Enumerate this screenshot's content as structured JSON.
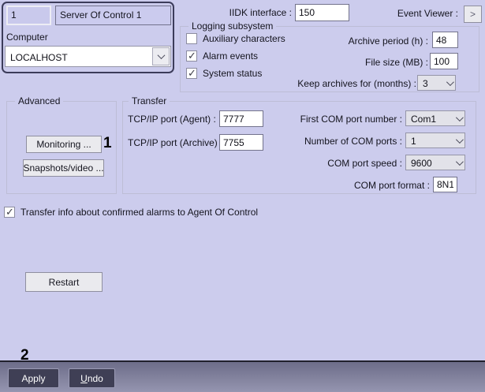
{
  "identity": {
    "id_value": "1",
    "name_value": "Server Of Control 1",
    "computer_label": "Computer",
    "computer_value": "LOCALHOST"
  },
  "iidk": {
    "label": "IIDK interface :",
    "value": "150"
  },
  "event_viewer": {
    "label": "Event Viewer :",
    "button_glyph": ">"
  },
  "logging": {
    "title": "Logging subsystem",
    "checkboxes": [
      {
        "label": "Auxiliary characters",
        "checked": false
      },
      {
        "label": "Alarm events",
        "checked": true
      },
      {
        "label": "System status",
        "checked": true
      }
    ],
    "archive_period_label": "Archive period (h) :",
    "archive_period_value": "48",
    "file_size_label": "File size (MB) :",
    "file_size_value": "100",
    "keep_archives_label": "Keep archives for (months) :",
    "keep_archives_value": "3"
  },
  "advanced": {
    "title": "Advanced",
    "monitoring_button": "Monitoring ...",
    "snapshots_button": "Snapshots/video ...",
    "annotation": "1"
  },
  "transfer": {
    "title": "Transfer",
    "agent_port_label": "TCP/IP port (Agent) :",
    "agent_port_value": "7777",
    "archive_port_label": "TCP/IP port (Archive) :",
    "archive_port_value": "7755",
    "first_com_label": "First COM port number :",
    "first_com_value": "Com1",
    "num_com_label": "Number of COM ports :",
    "num_com_value": "1",
    "com_speed_label": "COM port speed :",
    "com_speed_value": "9600",
    "com_format_label": "COM port format :",
    "com_format_value": "8N1"
  },
  "transfer_info": {
    "label": "Transfer info about confirmed alarms to Agent Of Control",
    "checked": true
  },
  "restart_button": "Restart",
  "footer": {
    "annotation": "2",
    "apply_button": "Apply",
    "undo_accel": "U",
    "undo_rest": "ndo"
  },
  "colors": {
    "background": "#cccced",
    "footer_top": "#6d6d89",
    "footer_bottom": "#9595b0",
    "dark_button": "#3f3f55",
    "group_border": "#bdbdd6"
  }
}
